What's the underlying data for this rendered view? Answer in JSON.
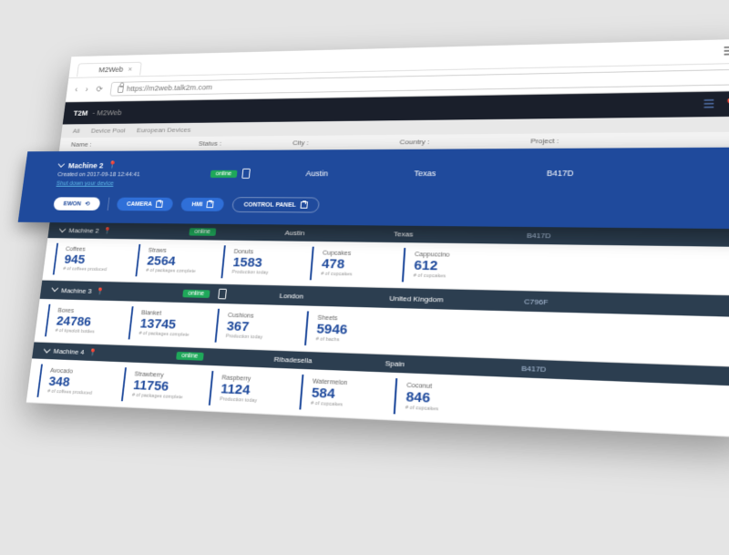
{
  "browser": {
    "tab_title": "M2Web",
    "url": "https://m2web.talk2m.com"
  },
  "header": {
    "brand": "T2M",
    "subtitle": "- M2Web"
  },
  "filters": {
    "all": "All",
    "device_pool": "Device Pool",
    "european": "European Devices"
  },
  "columns": {
    "name": "Name :",
    "status": "Status :",
    "city": "City :",
    "country": "Country :",
    "project": "Project :"
  },
  "expanded": {
    "name": "Machine 2",
    "created": "Created on 2017-09-18 12:44:41",
    "shutdown_link": "Shut down your device",
    "status": "online",
    "city": "Austin",
    "country": "Texas",
    "project": "B417D",
    "btn_ewon": "EWON",
    "btn_camera": "CAMERA",
    "btn_hmi": "HMI",
    "btn_control": "CONTROL PANEL"
  },
  "machines": [
    {
      "name": "Machine 2",
      "status": "online",
      "city": "Austin",
      "country": "Texas",
      "project": "B417D",
      "kpis": [
        {
          "label": "Coffees",
          "value": "945",
          "sub": "# of coffees produced"
        },
        {
          "label": "Straws",
          "value": "2564",
          "sub": "# of packages complete"
        },
        {
          "label": "Donuts",
          "value": "1583",
          "sub": "Production today"
        },
        {
          "label": "Cupcakes",
          "value": "478",
          "sub": "# of cupcakes"
        },
        {
          "label": "Cappuccino",
          "value": "612",
          "sub": "# of cupcakes"
        }
      ]
    },
    {
      "name": "Machine 3",
      "status": "online",
      "city": "London",
      "country": "United Kingdom",
      "project": "C796F",
      "kpis": [
        {
          "label": "Boxes",
          "value": "24786",
          "sub": "# of tipsololt bottles"
        },
        {
          "label": "Blanket",
          "value": "13745",
          "sub": "# of packages complete"
        },
        {
          "label": "Cushions",
          "value": "367",
          "sub": "Production today"
        },
        {
          "label": "Sheets",
          "value": "5946",
          "sub": "# of bachs"
        }
      ]
    },
    {
      "name": "Machine 4",
      "status": "online",
      "city": "Ribadesella",
      "country": "Spain",
      "project": "B417D",
      "kpis": [
        {
          "label": "Avocado",
          "value": "348",
          "sub": "# of coffees produced"
        },
        {
          "label": "Strawberry",
          "value": "11756",
          "sub": "# of packages complete"
        },
        {
          "label": "Raspberry",
          "value": "1124",
          "sub": "Production today"
        },
        {
          "label": "Watermelon",
          "value": "584",
          "sub": "# of cupcakes"
        },
        {
          "label": "Coconut",
          "value": "846",
          "sub": "# of cupcakes"
        }
      ]
    }
  ]
}
